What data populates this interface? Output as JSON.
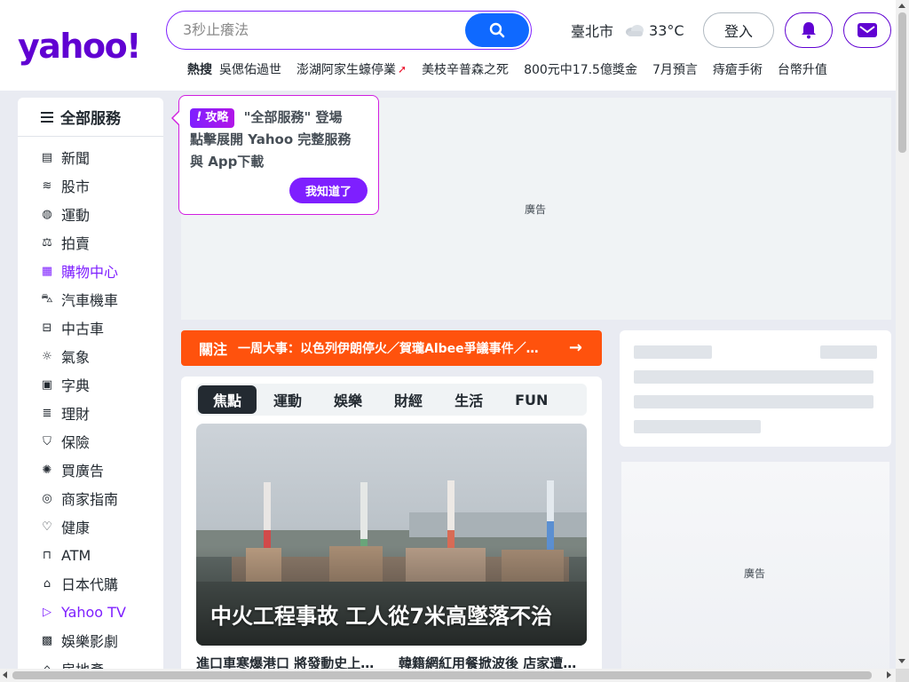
{
  "brand": {
    "logo_text": "yahoo!",
    "accent": "#6001d2",
    "search_blue": "#0f69ff",
    "focus_orange": "#ff520d"
  },
  "search": {
    "placeholder": "3秒止癢法",
    "button_icon": "search-icon"
  },
  "weather": {
    "city": "臺北市",
    "icon": "cloud-icon",
    "temperature": "33°C"
  },
  "header": {
    "login_label": "登入",
    "bell_icon": "bell-icon",
    "mail_icon": "mail-icon"
  },
  "trending": {
    "label": "熱搜",
    "items": [
      {
        "text": "吳偲佑過世",
        "hot": false
      },
      {
        "text": "澎湖阿家生蠔停業",
        "hot": true
      },
      {
        "text": "美枝辛普森之死",
        "hot": false
      },
      {
        "text": "800元中17.5億獎金",
        "hot": false
      },
      {
        "text": "7月預言",
        "hot": false
      },
      {
        "text": "痔瘡手術",
        "hot": false
      },
      {
        "text": "台幣升值",
        "hot": false
      }
    ]
  },
  "sidebar": {
    "header": "全部服務",
    "items": [
      {
        "label": "新聞",
        "icon": "newspaper-icon",
        "glyph": "▤",
        "highlight": false
      },
      {
        "label": "股市",
        "icon": "stock-chart-icon",
        "glyph": "≋",
        "highlight": false
      },
      {
        "label": "運動",
        "icon": "ball-icon",
        "glyph": "◍",
        "highlight": false
      },
      {
        "label": "拍賣",
        "icon": "auction-icon",
        "glyph": "⚖",
        "highlight": false
      },
      {
        "label": "購物中心",
        "icon": "shopping-icon",
        "glyph": "▦",
        "highlight": true
      },
      {
        "label": "汽車機車",
        "icon": "car-moto-icon",
        "glyph": "⛍",
        "highlight": false
      },
      {
        "label": "中古車",
        "icon": "car-icon",
        "glyph": "⊟",
        "highlight": false
      },
      {
        "label": "氣象",
        "icon": "sun-icon",
        "glyph": "☼",
        "highlight": false
      },
      {
        "label": "字典",
        "icon": "dictionary-icon",
        "glyph": "▣",
        "highlight": false
      },
      {
        "label": "理財",
        "icon": "coins-icon",
        "glyph": "≣",
        "highlight": false
      },
      {
        "label": "保險",
        "icon": "shield-icon",
        "glyph": "⛉",
        "highlight": false
      },
      {
        "label": "買廣告",
        "icon": "megaphone-icon",
        "glyph": "✺",
        "highlight": false
      },
      {
        "label": "商家指南",
        "icon": "target-icon",
        "glyph": "◎",
        "highlight": false
      },
      {
        "label": "健康",
        "icon": "heart-icon",
        "glyph": "♡",
        "highlight": false
      },
      {
        "label": "ATM",
        "icon": "atm-icon",
        "glyph": "⊓",
        "highlight": false
      },
      {
        "label": "日本代購",
        "icon": "bag-icon",
        "glyph": "⌂",
        "highlight": false
      },
      {
        "label": "Yahoo TV",
        "icon": "tv-icon",
        "glyph": "▷",
        "highlight": true
      },
      {
        "label": "娛樂影劇",
        "icon": "clapper-icon",
        "glyph": "▩",
        "highlight": false
      },
      {
        "label": "房地產",
        "icon": "house-icon",
        "glyph": "⌂",
        "highlight": false
      }
    ]
  },
  "tooltip": {
    "tag": "攻略",
    "line1": "\"全部服務\" 登場",
    "line2": "點擊展開 Yahoo 完整服務",
    "line3": "與 App下載",
    "button": "我知道了"
  },
  "ads": {
    "top_label": "廣告",
    "right_label": "廣告"
  },
  "focus": {
    "label": "關注",
    "text": "一周大事：以色列伊朗停火／賀瓏Albee爭議事件／賴清德罷免風波",
    "arrow": "→"
  },
  "news": {
    "tabs": [
      "焦點",
      "運動",
      "娛樂",
      "財經",
      "生活",
      "FUN"
    ],
    "active_tab": 0,
    "hero_title": "中火工程事故 工人從7米高墜落不治",
    "sub_left": "進口車寒爆港口 將發動史上最大降價潮",
    "sub_right": "韓籍網紅用餐掀波後 店家遭出征"
  }
}
